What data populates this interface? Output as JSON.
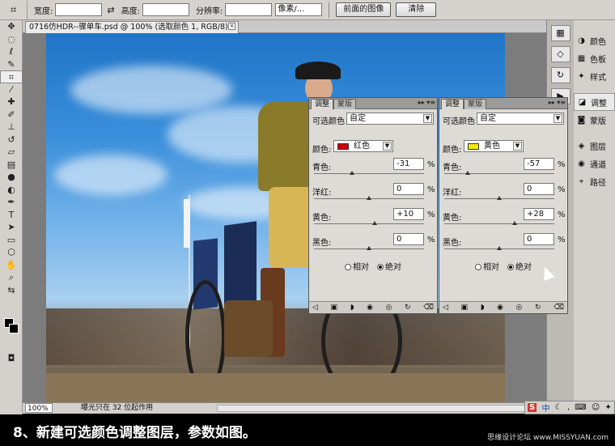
{
  "options_bar": {
    "tool_icon": "crop-icon",
    "width_label": "宽度:",
    "height_label": "高度:",
    "resolution_label": "分辨率:",
    "resolution_unit": "像素/...",
    "front_image_button": "前面的图像",
    "clear_button": "清除"
  },
  "document": {
    "tab_title": "0716仿HDR--骤单车.psd @ 100% (选取颜色 1, RGB/8) *"
  },
  "status_bar": {
    "zoom": "100%",
    "info": "曝光只在 32 位起作用"
  },
  "right_panel": {
    "items": [
      {
        "label": "颜色",
        "icon": "color-icon"
      },
      {
        "label": "色板",
        "icon": "swatches-icon"
      },
      {
        "label": "样式",
        "icon": "styles-icon"
      },
      {
        "label": "调整",
        "icon": "adjust-icon"
      },
      {
        "label": "蒙版",
        "icon": "mask-icon"
      },
      {
        "label": "图层",
        "icon": "layers-icon"
      },
      {
        "label": "通道",
        "icon": "channels-icon"
      },
      {
        "label": "路径",
        "icon": "paths-icon"
      }
    ]
  },
  "panels": [
    {
      "tab_adjust": "调整",
      "tab_mask": "蒙版",
      "title": "可选颜色",
      "preset": "自定",
      "color_label": "颜色:",
      "color_value": "红色",
      "color_swatch": "#cc0000",
      "sliders": [
        {
          "label": "青色:",
          "value": "-31",
          "fraction": 0.345
        },
        {
          "label": "洋红:",
          "value": "0",
          "fraction": 0.5
        },
        {
          "label": "黄色:",
          "value": "+10",
          "fraction": 0.55
        },
        {
          "label": "黑色:",
          "value": "0",
          "fraction": 0.5
        }
      ],
      "relative_label": "相对",
      "absolute_label": "绝对",
      "mode": "absolute"
    },
    {
      "tab_adjust": "调整",
      "tab_mask": "蒙版",
      "title": "可选颜色",
      "preset": "自定",
      "color_label": "颜色:",
      "color_value": "黄色",
      "color_swatch": "#f2ea00",
      "sliders": [
        {
          "label": "青色:",
          "value": "-57",
          "fraction": 0.215
        },
        {
          "label": "洋红:",
          "value": "0",
          "fraction": 0.5
        },
        {
          "label": "黄色:",
          "value": "+28",
          "fraction": 0.64
        },
        {
          "label": "黑色:",
          "value": "0",
          "fraction": 0.5
        }
      ],
      "relative_label": "相对",
      "absolute_label": "绝对",
      "mode": "absolute"
    }
  ],
  "percent_sign": "%",
  "ime": {
    "s_label": "S",
    "zh_label": "中"
  },
  "caption": {
    "text": "8、新建可选颜色调整图层，参数如图。",
    "watermark": "思缘设计论坛 www.MISSYUAN.com"
  }
}
